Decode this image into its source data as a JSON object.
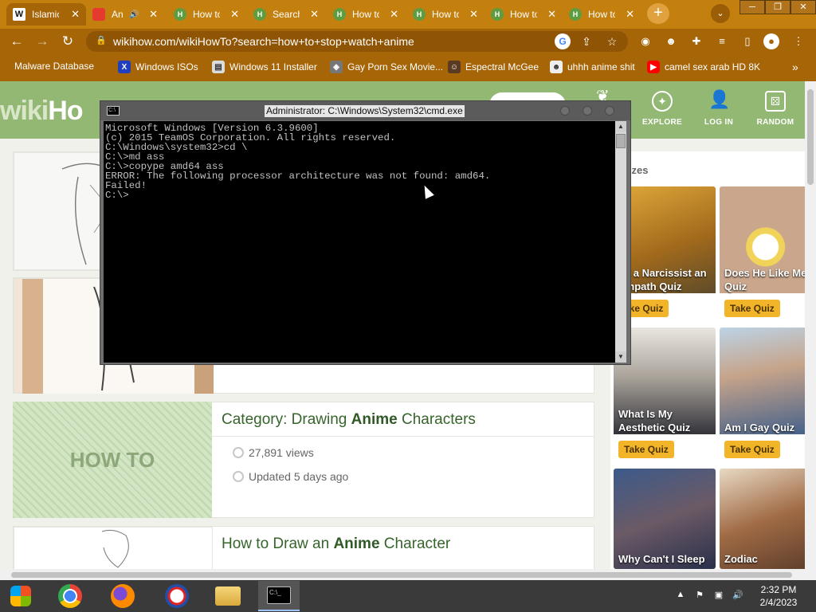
{
  "browser": {
    "tabs": [
      {
        "label": "Islamic",
        "favicon": "W"
      },
      {
        "label": "An",
        "favicon": ""
      },
      {
        "label": "How to",
        "favicon": "H"
      },
      {
        "label": "Search",
        "favicon": "H"
      },
      {
        "label": "How to",
        "favicon": "H"
      },
      {
        "label": "How to",
        "favicon": "H"
      },
      {
        "label": "How to",
        "favicon": "H"
      },
      {
        "label": "How to",
        "favicon": "H"
      }
    ],
    "new_tab": "+",
    "url": "wikihow.com/wikiHowTo?search=how+to+stop+watch+anime",
    "bookmarks": [
      {
        "label": "Malware Database"
      },
      {
        "label": "Windows ISOs"
      },
      {
        "label": "Windows 11 Installer"
      },
      {
        "label": "Gay Porn Sex Movie..."
      },
      {
        "label": "Espectral McGee"
      },
      {
        "label": "uhhh anime shit"
      },
      {
        "label": "camel sex arab HD 8K"
      }
    ],
    "more_bookmarks": "»",
    "colors": {
      "chrome": "#a66507",
      "tabbar": "#c4800f"
    }
  },
  "site": {
    "logo_wiki": "wiki",
    "logo_how": "Ho",
    "nav": [
      {
        "label": "EXPLORE",
        "icon": "compass-icon"
      },
      {
        "label": "LOG IN",
        "icon": "user-icon"
      },
      {
        "label": "RANDOM",
        "icon": "dice-icon"
      }
    ],
    "sidebar_title": "zzes",
    "howto_text": "HOW TO",
    "articles": [
      {
        "title_prefix": "Category: Drawing ",
        "title_bold": "Anime",
        "title_suffix": " Characters",
        "views": "27,891 views",
        "updated": "Updated 5 days ago"
      },
      {
        "title_prefix": "How to Draw an ",
        "title_bold": "Anime",
        "title_suffix": " Character"
      }
    ],
    "quizzes": [
      {
        "name": "n I a Narcissist an Empath Quiz",
        "button": "ake Quiz"
      },
      {
        "name": "Does He Like Me Quiz",
        "button": "Take Quiz"
      },
      {
        "name": "What Is My Aesthetic Quiz",
        "button": "Take Quiz"
      },
      {
        "name": "Am I Gay Quiz",
        "button": "Take Quiz"
      },
      {
        "name": "Why Can't I Sleep",
        "button": ""
      },
      {
        "name": "Zodiac",
        "button": ""
      }
    ],
    "colors": {
      "header": "#93b874",
      "title": "#36642b",
      "quiz_button": "#f2b52a"
    }
  },
  "cmd": {
    "title": "Administrator: C:\\Windows\\System32\\cmd.exe",
    "lines": [
      "Microsoft Windows [Version 6.3.9600]",
      "(c) 2015 TeamOS Corporation. All rights reserved.",
      "",
      "C:\\Windows\\system32>cd \\",
      "",
      "C:\\>md ass",
      "",
      "C:\\>copype amd64 ass",
      "ERROR: The following processor architecture was not found: amd64.",
      "Failed!",
      "",
      "C:\\>"
    ]
  },
  "taskbar": {
    "time": "2:32 PM",
    "date": "2/4/2023",
    "apps": [
      {
        "name": "start-icon"
      },
      {
        "name": "chrome-icon"
      },
      {
        "name": "firefox-icon"
      },
      {
        "name": "obama-icon"
      },
      {
        "name": "file-explorer-icon"
      },
      {
        "name": "cmd-icon"
      }
    ]
  }
}
